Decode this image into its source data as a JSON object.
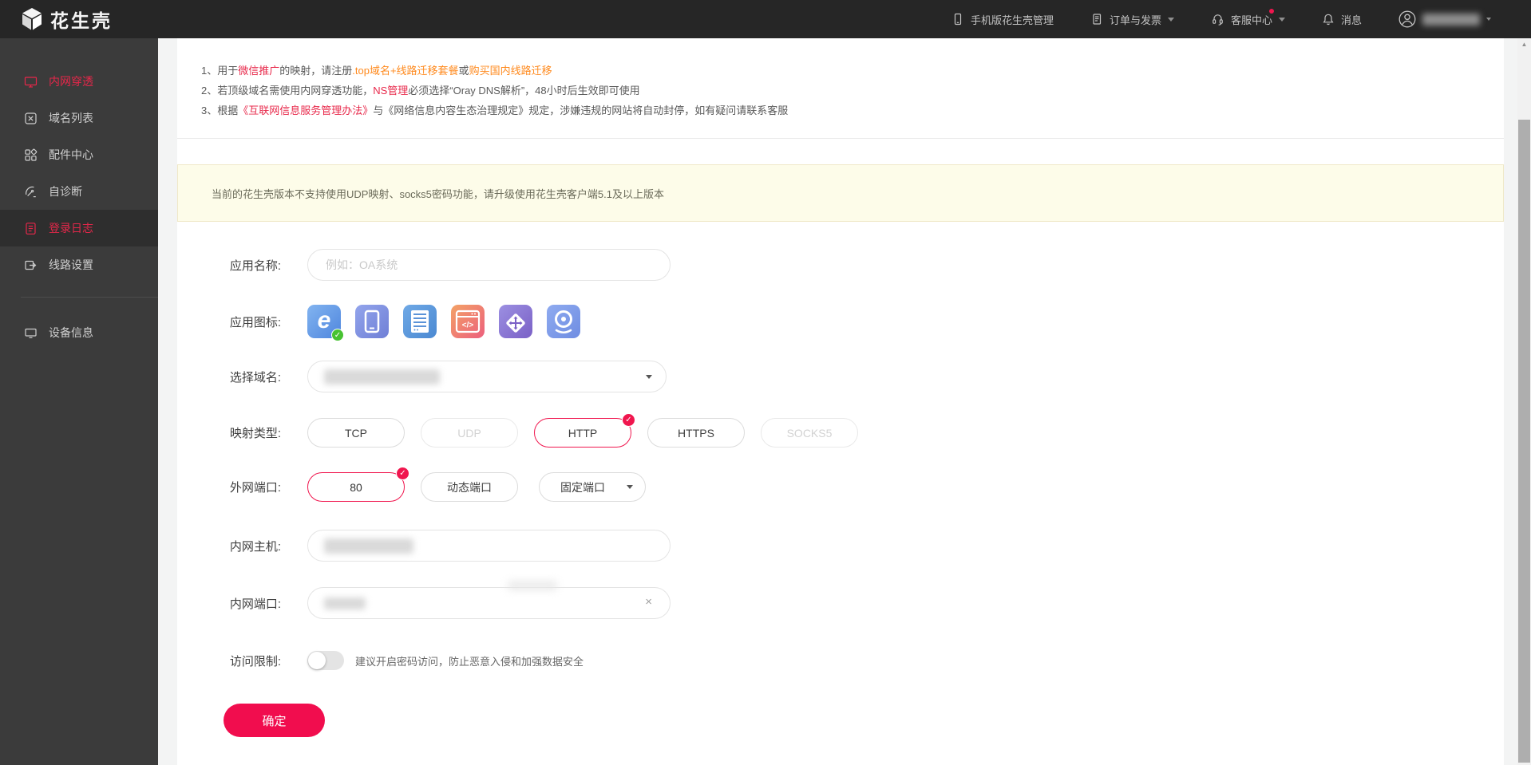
{
  "colors": {
    "accent": "#f0164e",
    "sidebar_active": "#e5274a",
    "link_red": "#e8294b",
    "link_orange": "#ff8a1e",
    "banner_bg": "#fdfce9",
    "submit_bg": "#f10d4e"
  },
  "header": {
    "brand": "花生壳",
    "nav": [
      {
        "label": "手机版花生壳管理",
        "icon": "mobile-icon"
      },
      {
        "label": "订单与发票",
        "icon": "invoice-icon"
      },
      {
        "label": "客服中心",
        "icon": "headset-icon"
      },
      {
        "label": "消息",
        "icon": "bell-icon"
      }
    ],
    "user": {
      "name_redacted": true
    }
  },
  "sidebar": {
    "items": [
      {
        "label": "内网穿透",
        "icon": "tunnel-icon",
        "state": "active"
      },
      {
        "label": "域名列表",
        "icon": "domain-icon",
        "state": "normal"
      },
      {
        "label": "配件中心",
        "icon": "accessories-icon",
        "state": "normal"
      },
      {
        "label": "自诊断",
        "icon": "diagnose-icon",
        "state": "normal"
      },
      {
        "label": "登录日志",
        "icon": "log-icon",
        "state": "selected"
      },
      {
        "label": "线路设置",
        "icon": "route-icon",
        "state": "normal"
      }
    ],
    "bottom_items": [
      {
        "label": "设备信息",
        "icon": "device-icon",
        "state": "normal"
      }
    ]
  },
  "notices": [
    [
      {
        "t": "1、用于"
      },
      {
        "t": "微信推广",
        "c": "red"
      },
      {
        "t": "的映射，请注册"
      },
      {
        "t": ".top域名+线路迁移套餐",
        "c": "orange",
        "link": true
      },
      {
        "t": "或"
      },
      {
        "t": "购买国内线路迁移",
        "c": "orange",
        "link": true
      }
    ],
    [
      {
        "t": "2、若顶级域名需使用内网穿透功能，"
      },
      {
        "t": "NS管理",
        "c": "red",
        "link": true
      },
      {
        "t": "必须选择“Oray DNS解析”，48小时后生效即可使用"
      }
    ],
    [
      {
        "t": "3、根据"
      },
      {
        "t": "《互联网信息服务管理办法》",
        "c": "red",
        "link": true
      },
      {
        "t": "与《网络信息内容生态治理规定》规定，涉嫌违规的网站将自动封停，如有疑问请联系客服"
      }
    ]
  ],
  "banner": {
    "text": "当前的花生壳版本不支持使用UDP映射、socks5密码功能，请升级使用花生壳客户端5.1及以上版本"
  },
  "form": {
    "app_name": {
      "label": "应用名称:",
      "placeholder": "例如：OA系统"
    },
    "app_icon": {
      "label": "应用图标:",
      "icons": [
        "browser-icon",
        "phone-icon",
        "server-icon",
        "code-icon",
        "router-icon",
        "camera-icon"
      ],
      "selected_index": 0
    },
    "domain": {
      "label": "选择域名:",
      "value_redacted": true
    },
    "map_type": {
      "label": "映射类型:",
      "options": [
        {
          "label": "TCP",
          "state": "normal"
        },
        {
          "label": "UDP",
          "state": "disabled"
        },
        {
          "label": "HTTP",
          "state": "selected"
        },
        {
          "label": "HTTPS",
          "state": "normal"
        },
        {
          "label": "SOCKS5",
          "state": "disabled"
        }
      ]
    },
    "ext_port": {
      "label": "外网端口:",
      "value": "80",
      "dynamic_button": "动态端口",
      "mode_select": "固定端口"
    },
    "lan_host": {
      "label": "内网主机:",
      "value_redacted": true
    },
    "lan_port": {
      "label": "内网端口:",
      "value_redacted": true,
      "clear": "×"
    },
    "access": {
      "label": "访问限制:",
      "enabled": false,
      "hint": "建议开启密码访问，防止恶意入侵和加强数据安全"
    },
    "submit": "确定"
  }
}
